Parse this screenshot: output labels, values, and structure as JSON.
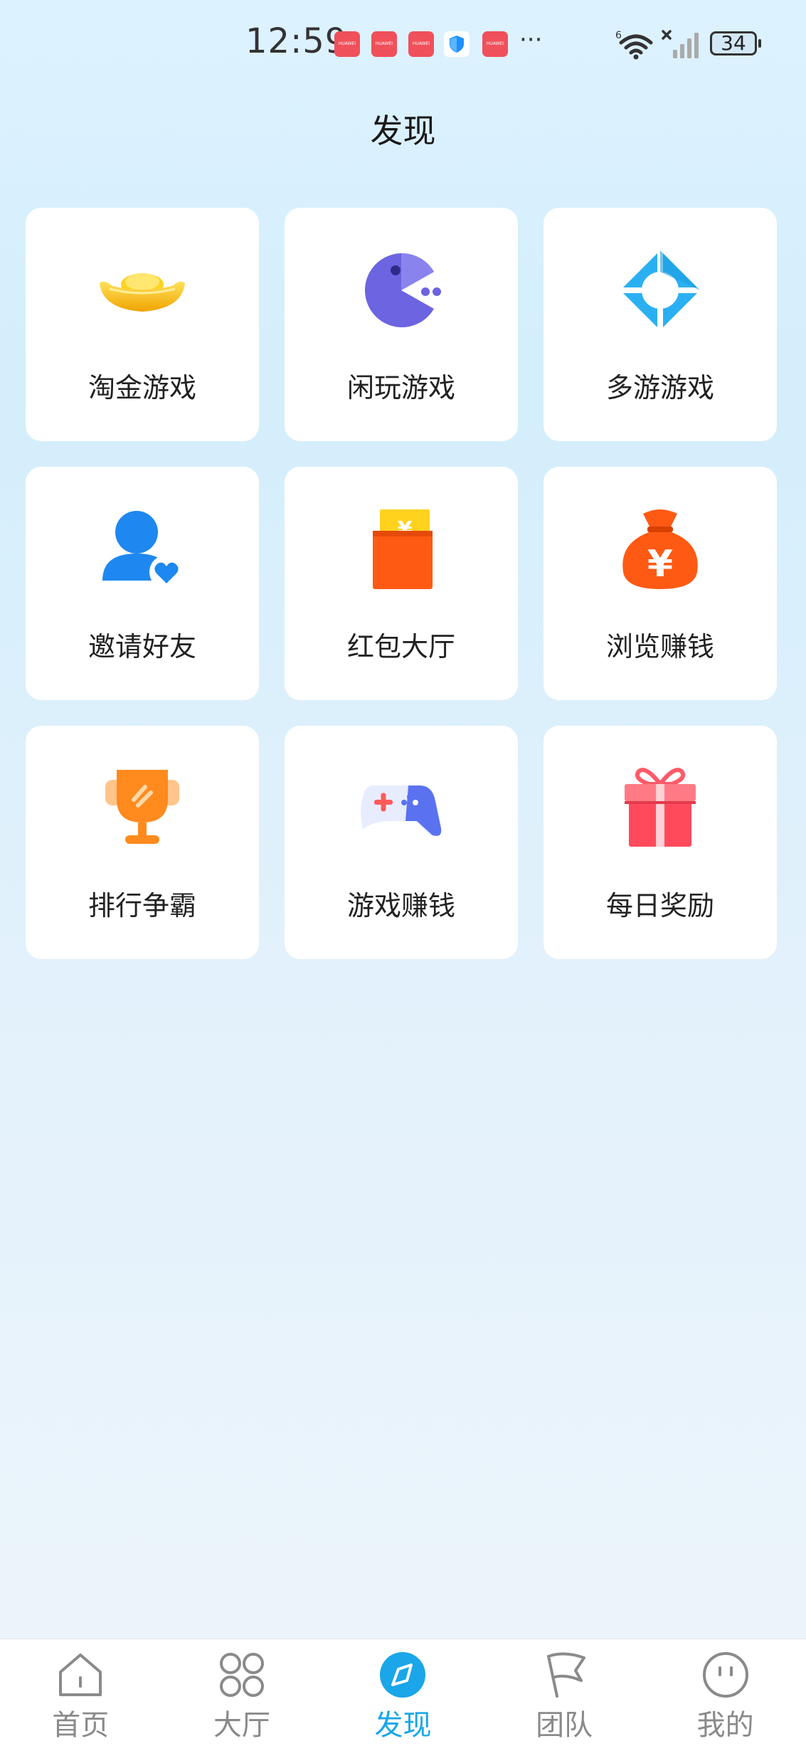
{
  "status_bar": {
    "time": "12:59",
    "notification_label": "HUAWEI",
    "more": "···",
    "network": "6",
    "battery": "34"
  },
  "page": {
    "title": "发现"
  },
  "grid_items": [
    {
      "label": "淘金游戏",
      "icon": "gold-ingot-icon"
    },
    {
      "label": "闲玩游戏",
      "icon": "pacman-icon"
    },
    {
      "label": "多游游戏",
      "icon": "diamond-ring-icon"
    },
    {
      "label": "邀请好友",
      "icon": "user-heart-icon"
    },
    {
      "label": "红包大厅",
      "icon": "red-envelope-icon"
    },
    {
      "label": "浏览赚钱",
      "icon": "money-bag-icon"
    },
    {
      "label": "排行争霸",
      "icon": "trophy-icon"
    },
    {
      "label": "游戏赚钱",
      "icon": "gamepad-icon"
    },
    {
      "label": "每日奖励",
      "icon": "gift-icon"
    }
  ],
  "bottom_nav": [
    {
      "label": "首页",
      "icon": "home-icon",
      "active": false
    },
    {
      "label": "大厅",
      "icon": "grid-circles-icon",
      "active": false
    },
    {
      "label": "发现",
      "icon": "compass-icon",
      "active": true
    },
    {
      "label": "团队",
      "icon": "flag-icon",
      "active": false
    },
    {
      "label": "我的",
      "icon": "smiley-icon",
      "active": false
    }
  ],
  "colors": {
    "accent": "#1aa6e8",
    "nav_inactive": "#8a8a8a"
  }
}
